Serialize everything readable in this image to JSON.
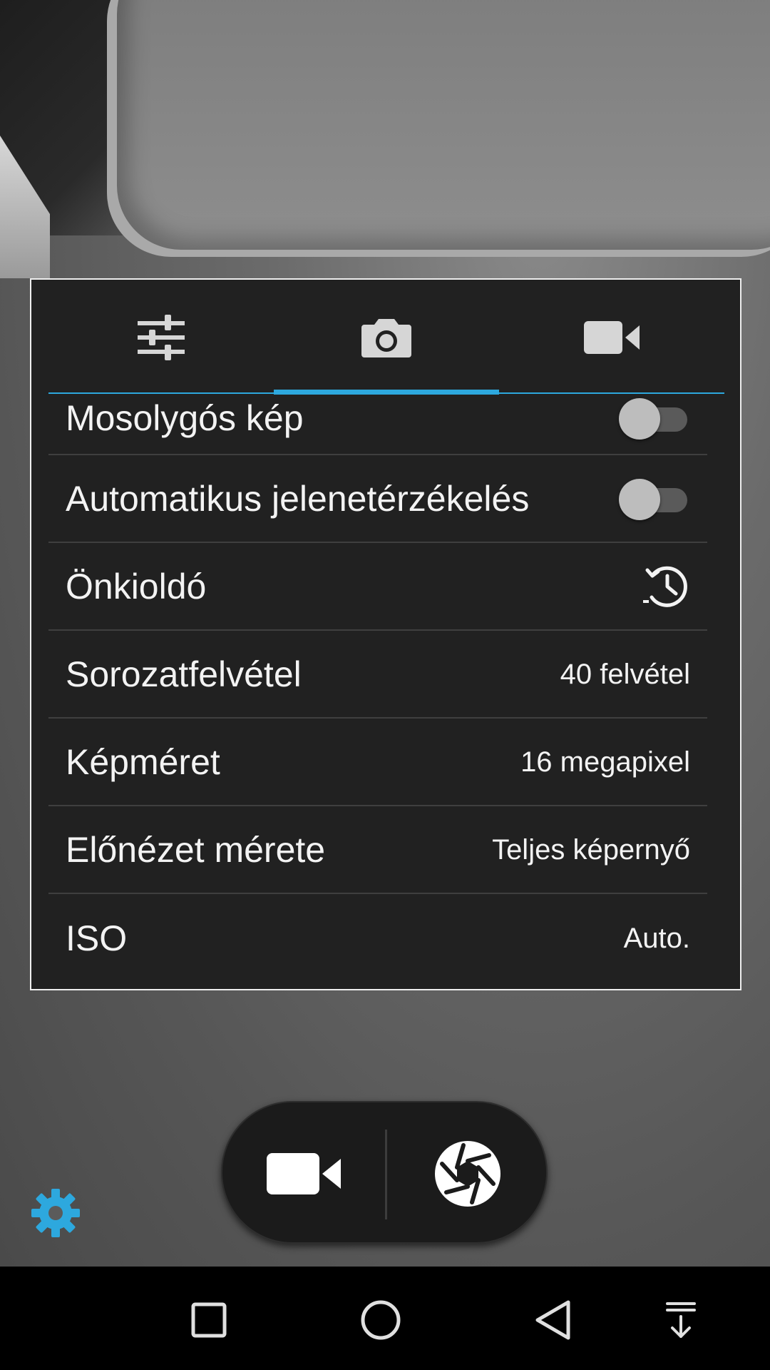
{
  "colors": {
    "accent": "#2da8de",
    "panel_bg": "#212121",
    "text": "#f3f3f3",
    "divider": "#3f3f3f"
  },
  "tabs": [
    {
      "name": "sliders-icon",
      "selected": false
    },
    {
      "name": "camera-icon",
      "selected": true
    },
    {
      "name": "video-camera-icon",
      "selected": false
    }
  ],
  "settings": {
    "smile_shot": {
      "label": "Mosolygós kép",
      "control": "toggle",
      "on": false
    },
    "auto_scene": {
      "label": "Automatikus jelenetérzékelés",
      "control": "toggle",
      "on": false
    },
    "self_timer": {
      "label": "Önkioldó",
      "control": "icon",
      "icon": "timer-icon"
    },
    "burst": {
      "label": "Sorozatfelvétel",
      "value": "40 felvétel"
    },
    "picture_size": {
      "label": "Képméret",
      "value": "16 megapixel"
    },
    "preview_size": {
      "label": "Előnézet mérete",
      "value": "Teljes képernyő"
    },
    "iso": {
      "label": "ISO",
      "value": "Auto."
    }
  },
  "capture_controls": {
    "left": "video-camera-icon",
    "right": "shutter-aperture-icon"
  },
  "settings_gear": "gear-icon",
  "navigation": [
    "recent-apps-icon",
    "home-icon",
    "back-icon",
    "notification-pull-down-icon"
  ]
}
